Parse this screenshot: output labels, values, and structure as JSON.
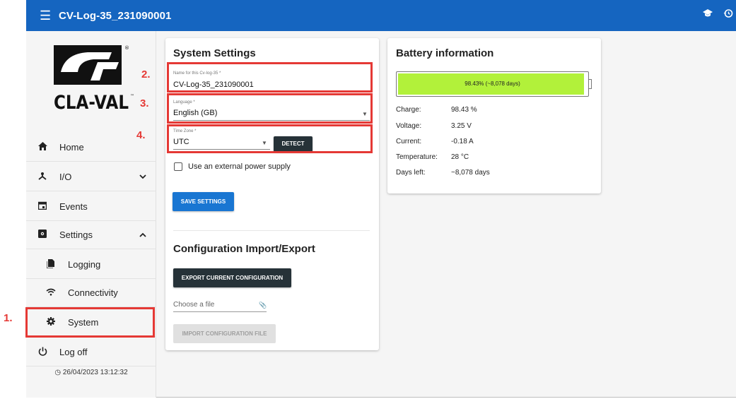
{
  "appbar": {
    "menu_icon": "menu-icon",
    "title": "CV-Log-35_231090001",
    "icons": [
      "school-icon",
      "history-icon"
    ]
  },
  "sidebar": {
    "logo_text": "CLA-VAL",
    "items": [
      {
        "label": "Home",
        "icon": "home-icon"
      },
      {
        "label": "I/O",
        "icon": "io-icon",
        "chevron": "chevron-down"
      },
      {
        "label": "Events",
        "icon": "calendar-icon"
      },
      {
        "label": "Settings",
        "icon": "settings-icon",
        "chevron": "chevron-up"
      },
      {
        "label": "Logging",
        "icon": "file-icon"
      },
      {
        "label": "Connectivity",
        "icon": "wifi-icon"
      },
      {
        "label": "System",
        "icon": "gear-icon"
      },
      {
        "label": "Log off",
        "icon": "power-icon"
      }
    ],
    "clock": "26/04/2023 13:12:32"
  },
  "system_settings": {
    "title": "System Settings",
    "name_label": "Name for this Cv-log-35 *",
    "name_value": "CV-Log-35_231090001",
    "language_label": "Language *",
    "language_value": "English (GB)",
    "timezone_label": "Time Zone *",
    "timezone_value": "UTC",
    "detect_label": "DETECT",
    "external_power_label": "Use an external power supply",
    "external_power_checked": false,
    "save_label": "SAVE SETTINGS"
  },
  "config": {
    "title": "Configuration Import/Export",
    "export_label": "EXPORT CURRENT CONFIGURATION",
    "file_placeholder": "Choose a file",
    "import_label": "IMPORT CONFIGURATION FILE"
  },
  "battery": {
    "title": "Battery information",
    "bar_label": "98.43% (~8,078 days)",
    "level": 0.9843,
    "bar_color": "#b2f13a",
    "rows": [
      {
        "label": "Charge:",
        "value": "98.43 %"
      },
      {
        "label": "Voltage:",
        "value": "3.25 V"
      },
      {
        "label": "Current:",
        "value": "-0.18 A"
      },
      {
        "label": "Temperature:",
        "value": "28 °C"
      },
      {
        "label": "Days left:",
        "value": "~8,078 days"
      }
    ]
  },
  "annotations": [
    "1.",
    "2.",
    "3.",
    "4."
  ],
  "colors": {
    "appbar": "#1565c0",
    "highlight": "#e53935",
    "primary": "#1976d2",
    "dark_button": "#263238"
  }
}
